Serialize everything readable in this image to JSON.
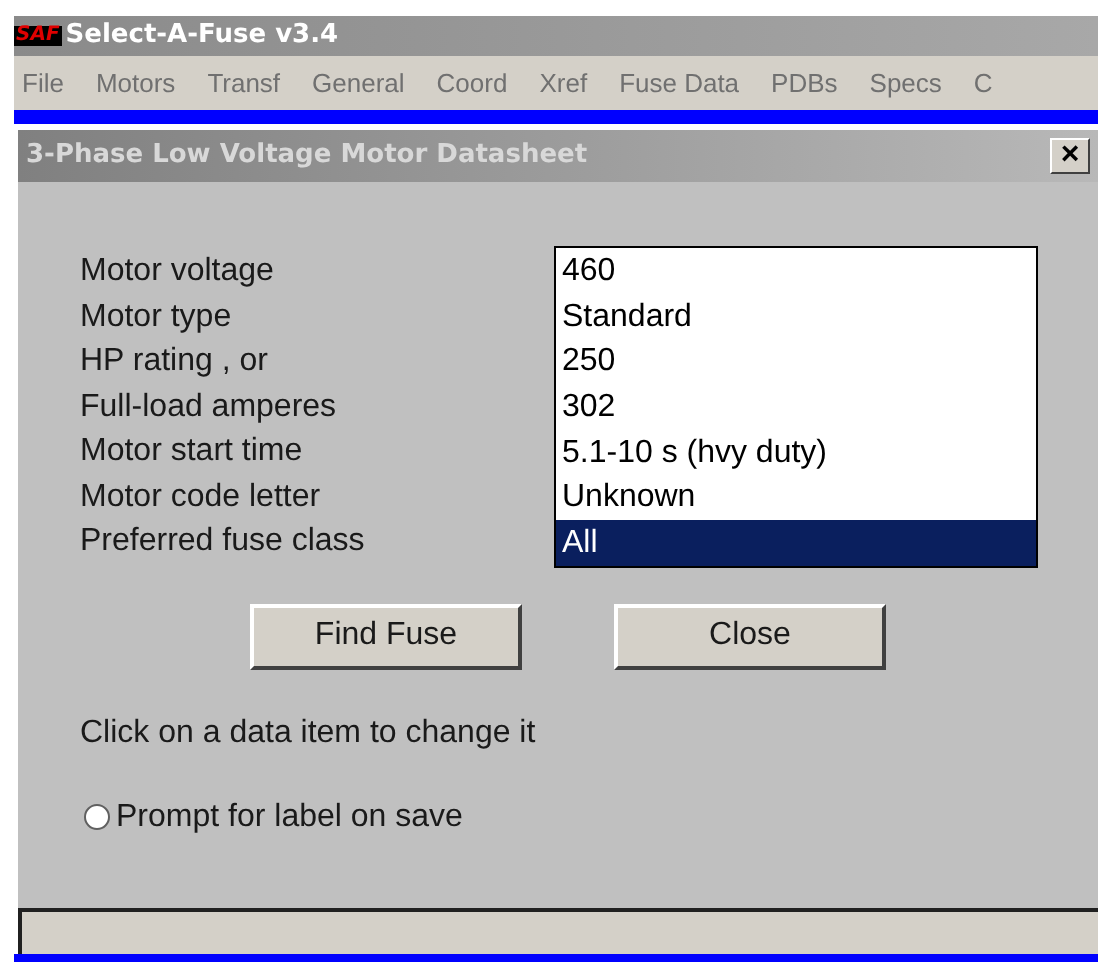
{
  "app_window": {
    "title": "Select-A-Fuse v3.4",
    "logo": "SAF"
  },
  "menu": [
    "File",
    "Motors",
    "Transf",
    "General",
    "Coord",
    "Xref",
    "Fuse Data",
    "PDBs",
    "Specs",
    "C"
  ],
  "dialog": {
    "title": "3-Phase Low Voltage Motor Datasheet",
    "close": "×",
    "fields": [
      {
        "label": "Motor voltage",
        "value": "460",
        "selected": false
      },
      {
        "label": "Motor type",
        "value": "Standard",
        "selected": false
      },
      {
        "label": "HP rating , or",
        "value": "250",
        "selected": false
      },
      {
        "label": "Full-load amperes",
        "value": "302",
        "selected": false
      },
      {
        "label": "Motor start time",
        "value": "5.1-10 s (hvy duty)",
        "selected": false
      },
      {
        "label": "Motor code letter",
        "value": "Unknown",
        "selected": false
      },
      {
        "label": "Preferred fuse class",
        "value": "All",
        "selected": true
      }
    ],
    "buttons": [
      "Find Fuse",
      "Close"
    ],
    "hint": "Click on a data item to change it",
    "option": {
      "label": "Prompt for label on save",
      "selected": false
    }
  }
}
